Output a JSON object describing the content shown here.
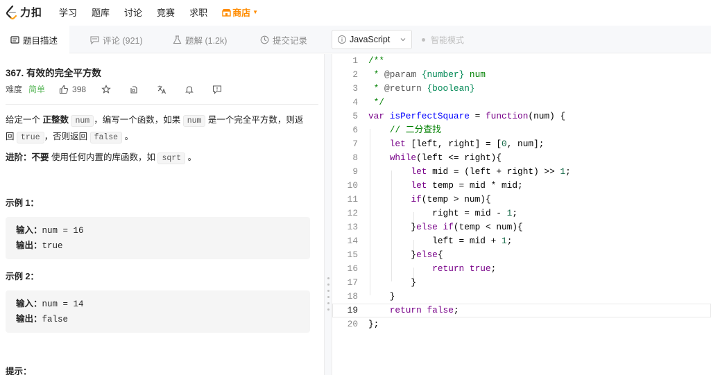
{
  "nav": {
    "logo_text": "力扣",
    "items": [
      "学习",
      "题库",
      "讨论",
      "竞赛",
      "求职"
    ],
    "shop": "商店"
  },
  "tabs": {
    "description": "题目描述",
    "comments": "评论 (921)",
    "solutions": "题解 (1.2k)",
    "submissions": "提交记录"
  },
  "editor_bar": {
    "language": "JavaScript",
    "smart_mode": "智能模式"
  },
  "problem": {
    "title": "367. 有效的完全平方数",
    "difficulty_label": "难度",
    "difficulty": "简单",
    "likes": "398",
    "desc_1": "给定一个 ",
    "desc_bold": "正整数",
    "desc_code_num": "num",
    "desc_2": "，编写一个函数，如果 ",
    "desc_code_num2": "num",
    "desc_3": " 是一个完全平方数，则返回 ",
    "desc_code_true": "true",
    "desc_4": "，否则返回 ",
    "desc_code_false": "false",
    "desc_5": " 。",
    "advance_label": "进阶：",
    "advance_bold": "不要",
    "advance_text": " 使用任何内置的库函数，如  ",
    "advance_code": "sqrt",
    "advance_end": " 。",
    "example1_title": "示例 1：",
    "example1_input_label": "输入：",
    "example1_input": "num = 16",
    "example1_output_label": "输出：",
    "example1_output": "true",
    "example2_title": "示例 2：",
    "example2_input_label": "输入：",
    "example2_input": "num = 14",
    "example2_output_label": "输出：",
    "example2_output": "false",
    "hint_title": "提示："
  },
  "code_lines": [
    "/**",
    " * @param {number} num",
    " * @return {boolean}",
    " */",
    "var isPerfectSquare = function(num) {",
    "    // 二分查找",
    "    let [left, right] = [0, num];",
    "    while(left <= right){",
    "        let mid = (left + right) >> 1;",
    "        let temp = mid * mid;",
    "        if(temp > num){",
    "            right = mid - 1;",
    "        }else if(temp < num){",
    "            left = mid + 1;",
    "        }else{",
    "            return true;",
    "        }",
    "    }",
    "    return false;",
    "};"
  ],
  "colors": {
    "easy": "#5cb85c",
    "shop": "#ff8c00",
    "comment": "#008000",
    "keyword": "#770088",
    "def": "#0000ff",
    "number": "#116644"
  }
}
